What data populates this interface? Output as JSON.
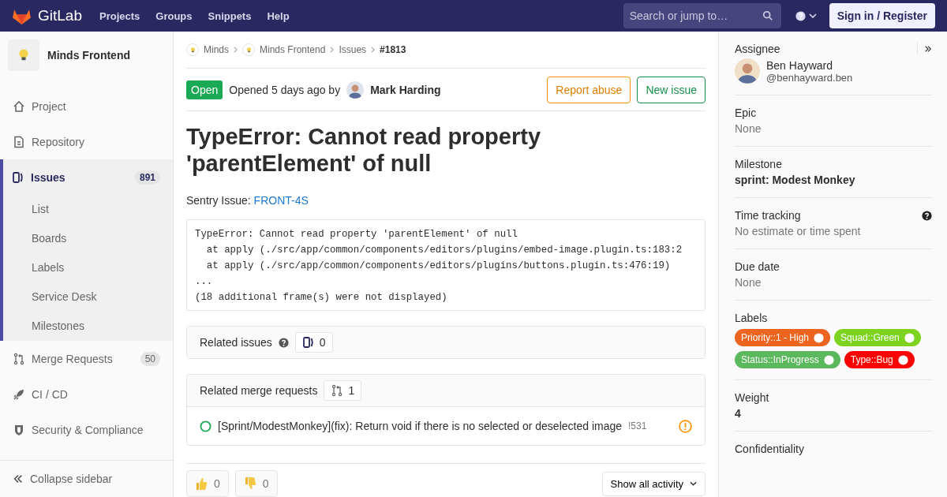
{
  "navbar": {
    "brand": "GitLab",
    "links": [
      "Projects",
      "Groups",
      "Snippets",
      "Help"
    ],
    "search": {
      "placeholder": "Search or jump to…"
    },
    "sign_in": "Sign in / Register"
  },
  "sidebar": {
    "project": "Minds Frontend",
    "items": [
      {
        "label": "Project",
        "kind": "home",
        "selected": false
      },
      {
        "label": "Repository",
        "kind": "repo",
        "selected": false
      },
      {
        "label": "Issues",
        "kind": "issues",
        "count": "891",
        "selected": true,
        "children": [
          {
            "label": "List"
          },
          {
            "label": "Boards"
          },
          {
            "label": "Labels"
          },
          {
            "label": "Service Desk"
          },
          {
            "label": "Milestones"
          }
        ]
      },
      {
        "label": "Merge Requests",
        "kind": "merge",
        "count": "50",
        "selected": false
      },
      {
        "label": "CI / CD",
        "kind": "rocket",
        "selected": false
      },
      {
        "label": "Security & Compliance",
        "kind": "shield",
        "selected": false
      }
    ],
    "collapse": "Collapse sidebar"
  },
  "breadcrumbs": [
    {
      "label": "Minds",
      "kind": "group"
    },
    {
      "label": "Minds Frontend",
      "kind": "group"
    },
    {
      "label": "Issues",
      "kind": "link"
    },
    {
      "label": "#1813",
      "kind": "current"
    }
  ],
  "issue": {
    "status": "Open",
    "opened": "Opened 5 days ago by",
    "author": "Mark Harding",
    "actions": [
      {
        "label": "Report abuse",
        "kind": "warning"
      },
      {
        "label": "New issue",
        "kind": "success"
      }
    ],
    "title": "TypeError: Cannot read property 'parentElement' of null",
    "description_label": "Sentry Issue:",
    "description_link": "FRONT-4S",
    "stacktrace": [
      "TypeError: Cannot read property 'parentElement' of null",
      "  at apply (./src/app/common/components/editors/plugins/embed-image.plugin.ts:183:2",
      "  at apply (./src/app/common/components/editors/plugins/buttons.plugin.ts:476:19)",
      "...",
      "(18 additional frame(s) were not displayed)"
    ]
  },
  "related_issues": {
    "title": "Related issues",
    "count": "0"
  },
  "related_merge_requests": {
    "title": "Related merge requests",
    "count": "1",
    "items": [
      {
        "title": "[Sprint/ModestMonkey](fix): Return void if there is no selected or deselected image",
        "ref": "!531"
      }
    ]
  },
  "awards": [
    {
      "kind": "thumbsup",
      "count": "0"
    },
    {
      "kind": "thumbsdown",
      "count": "0"
    }
  ],
  "activity_filter": "Show all activity",
  "right_sidebar": {
    "sections": [
      {
        "title": "Assignee",
        "kind": "assignee",
        "name": "Ben Hayward",
        "username": "@benhayward.ben"
      },
      {
        "title": "Epic",
        "kind": "muted",
        "value": "None"
      },
      {
        "title": "Milestone",
        "kind": "strong",
        "value": "sprint: Modest Monkey"
      },
      {
        "title": "Time tracking",
        "kind": "muted",
        "value": "No estimate or time spent",
        "help": true
      },
      {
        "title": "Due date",
        "kind": "muted",
        "value": "None"
      },
      {
        "title": "Labels",
        "kind": "labels",
        "labels": [
          {
            "label": "Priority::1 - High",
            "color": "#eb6420"
          },
          {
            "label": "Squad::Green",
            "color": "#7ed321"
          },
          {
            "label": "Status::InProgress",
            "color": "#5cb85c"
          },
          {
            "label": "Type::Bug",
            "color": "#ff0000"
          }
        ]
      },
      {
        "title": "Weight",
        "kind": "strong",
        "value": "4"
      },
      {
        "title": "Confidentiality",
        "kind": "title"
      }
    ]
  }
}
